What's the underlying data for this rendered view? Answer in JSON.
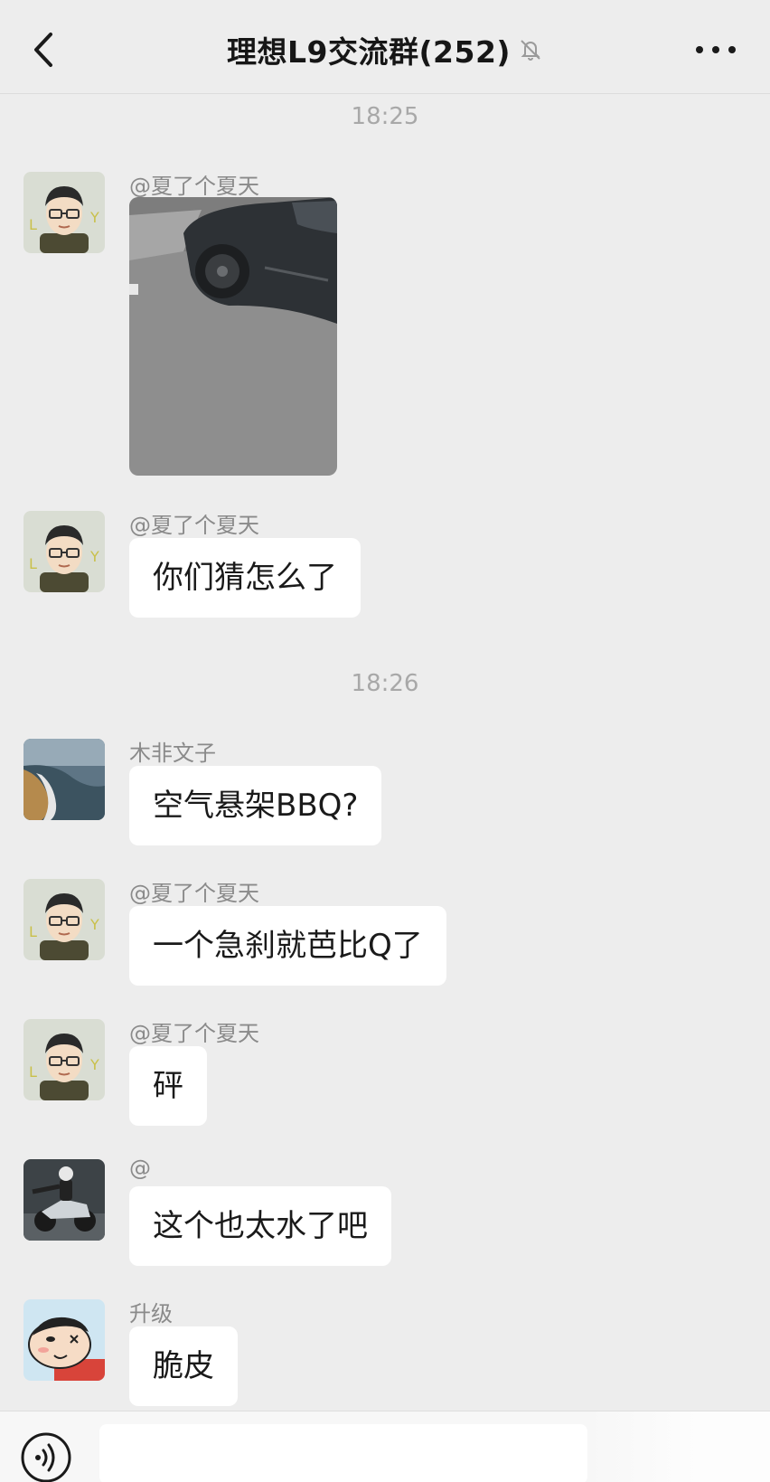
{
  "header": {
    "title": "理想L9交流群(252)",
    "back_icon": "chevron-left-icon",
    "mute_icon": "bell-off-icon",
    "more_icon": "more-dots-icon"
  },
  "timestamps": [
    "18:25",
    "18:26"
  ],
  "messages": [
    {
      "sender": "@夏了个夏天",
      "type": "image",
      "avatar": "cartoon-glasses-man-avatar"
    },
    {
      "sender": "@夏了个夏天",
      "type": "text",
      "text": "你们猜怎么了",
      "avatar": "cartoon-glasses-man-avatar"
    },
    {
      "sender": "木非文子",
      "type": "text",
      "text": "空气悬架BBQ?",
      "avatar": "beach-wave-avatar"
    },
    {
      "sender": "@夏了个夏天",
      "type": "text",
      "text": "一个急刹就芭比Q了",
      "avatar": "cartoon-glasses-man-avatar"
    },
    {
      "sender": "@夏了个夏天",
      "type": "text",
      "text": "砰",
      "avatar": "cartoon-glasses-man-avatar"
    },
    {
      "sender": "@",
      "type": "text",
      "text": "这个也太水了吧",
      "avatar": "motorcycle-rider-avatar"
    },
    {
      "sender": "升级",
      "type": "text",
      "text": "脆皮",
      "avatar": "crayon-shin-chan-avatar"
    }
  ],
  "input_bar": {
    "voice_icon": "voice-icon",
    "value": ""
  },
  "colors": {
    "background": "#ededed",
    "bubble": "#ffffff",
    "sender_text": "#8a8a8a",
    "timestamp_text": "#a8a8a8"
  }
}
